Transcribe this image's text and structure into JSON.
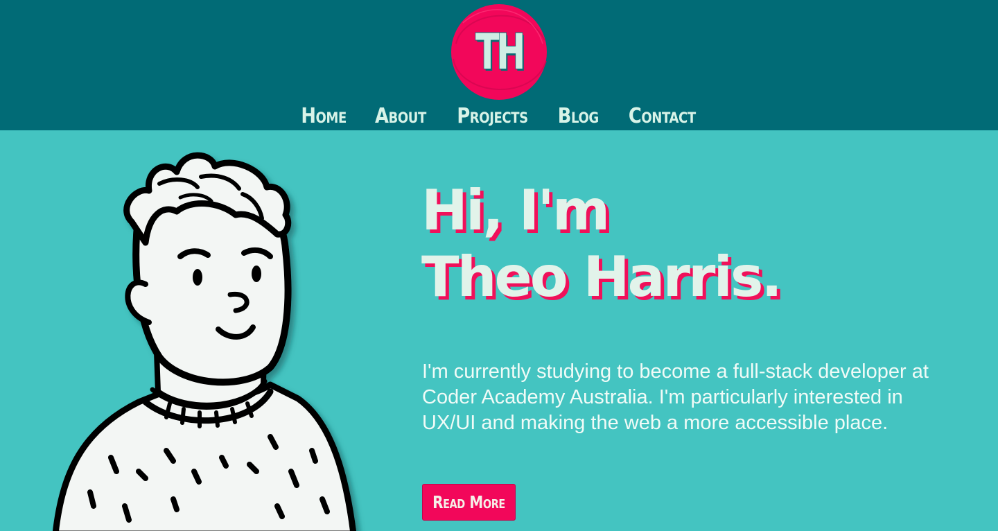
{
  "logo": {
    "initials": "TH",
    "badge_color": "#f2075a"
  },
  "nav": {
    "items": [
      {
        "label": "Home"
      },
      {
        "label": "About"
      },
      {
        "label": "Projects"
      },
      {
        "label": "Blog"
      },
      {
        "label": "Contact"
      }
    ]
  },
  "hero": {
    "greeting_line1": "Hi, I'm",
    "greeting_line2": "Theo Harris.",
    "intro": "I'm currently studying to become a full-stack developer at Coder Academy Australia. I'm particularly interested in UX/UI and making the web a more accessible place.",
    "cta_label": "Read More"
  },
  "colors": {
    "header_bg": "#016b76",
    "hero_bg": "#44c4c1",
    "accent": "#f2075a",
    "text_light": "#e2f3ea"
  },
  "icons": {
    "avatar": "avatar-illustration",
    "logo": "logo-badge"
  }
}
